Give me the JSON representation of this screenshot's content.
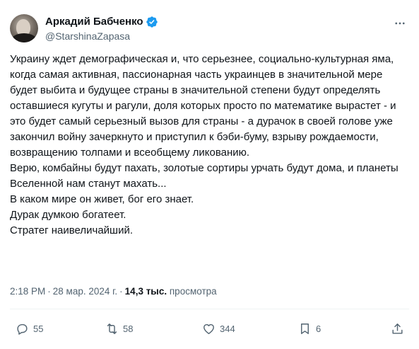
{
  "author": {
    "name": "Аркадий Бабченко",
    "handle": "@StarshinaZapasa",
    "avatar_icon": "avatar-photo",
    "verified_color": "#1d9bf0"
  },
  "tweet": {
    "paragraphs": [
      "Украину ждет демографическая и, что серьезнее, социально-культурная яма, когда самая активная, пассионарная часть украинцев в значительной мере будет выбита и будущее страны в значительной степени будут определять оставшиеся кугуты и рагули, доля которых просто по математике вырастет - и это будет самый серьезный вызов для страны - а дурачок в своей голове уже закончил войну зачеркнуто и приступил к бэби-буму, взрыву рождаемости, возвращению толпами и всеобщему ликованию.",
      "Верю, комбайны будут пахать, золотые сортиры урчать будут дома, и планеты Вселенной нам станут махать...",
      "В каком мире он живет, бог его знает.",
      "Дурак думкою богатеет.",
      "Стратег наивеличайший."
    ]
  },
  "meta": {
    "time": "2:18 PM",
    "separator": "·",
    "date": "28 мар. 2024 г.",
    "views_count": "14,3 тыс.",
    "views_label": "просмотра"
  },
  "actions": {
    "replies": "55",
    "reposts": "58",
    "likes": "344",
    "bookmarks": "6"
  }
}
